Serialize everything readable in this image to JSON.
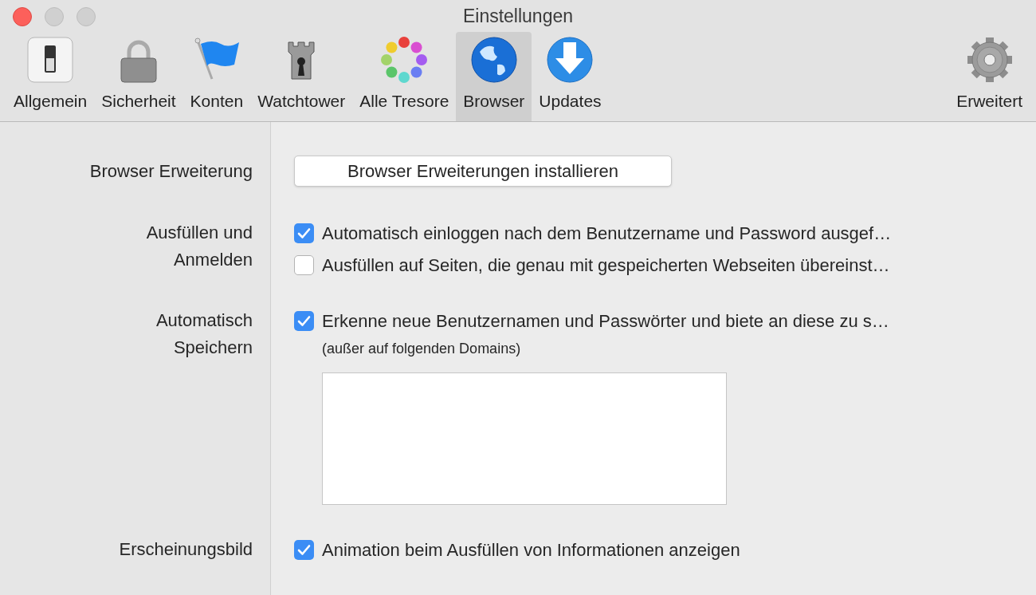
{
  "window": {
    "title": "Einstellungen"
  },
  "toolbar": [
    {
      "label": "Allgemein",
      "kind": "toggle",
      "selected": false
    },
    {
      "label": "Sicherheit",
      "kind": "lock",
      "selected": false
    },
    {
      "label": "Konten",
      "kind": "flag",
      "selected": false
    },
    {
      "label": "Watchtower",
      "kind": "tower",
      "selected": false
    },
    {
      "label": "Alle Tresore",
      "kind": "dots",
      "selected": false
    },
    {
      "label": "Browser",
      "kind": "globe",
      "selected": true
    },
    {
      "label": "Updates",
      "kind": "download",
      "selected": false
    },
    {
      "label": "Erweitert",
      "kind": "gear",
      "selected": false
    }
  ],
  "sections": [
    {
      "label": "Browser Erweiterung",
      "kind": "button",
      "button": "Browser Erweiterungen installieren"
    },
    {
      "label": "Ausfüllen und Anmelden",
      "kind": "checks",
      "options": [
        {
          "label": "Automatisch einloggen nach dem Benutzername und Password ausgef…",
          "checked": true
        },
        {
          "label": "Ausfüllen auf Seiten, die genau mit gespeicherten Webseiten übereinst…",
          "checked": false
        }
      ]
    },
    {
      "label": "Automatisch Speichern",
      "options": [
        {
          "label": "Erkenne neue Benutzernamen und Passwörter und biete an diese zu s…",
          "checked": true
        }
      ],
      "note": "(außer auf folgenden Domains)",
      "kind": "checks_with_list"
    },
    {
      "label": "Erscheinungsbild",
      "kind": "checks",
      "options": [
        {
          "label": "Animation beim Ausfüllen von Informationen anzeigen",
          "checked": true
        }
      ]
    }
  ]
}
